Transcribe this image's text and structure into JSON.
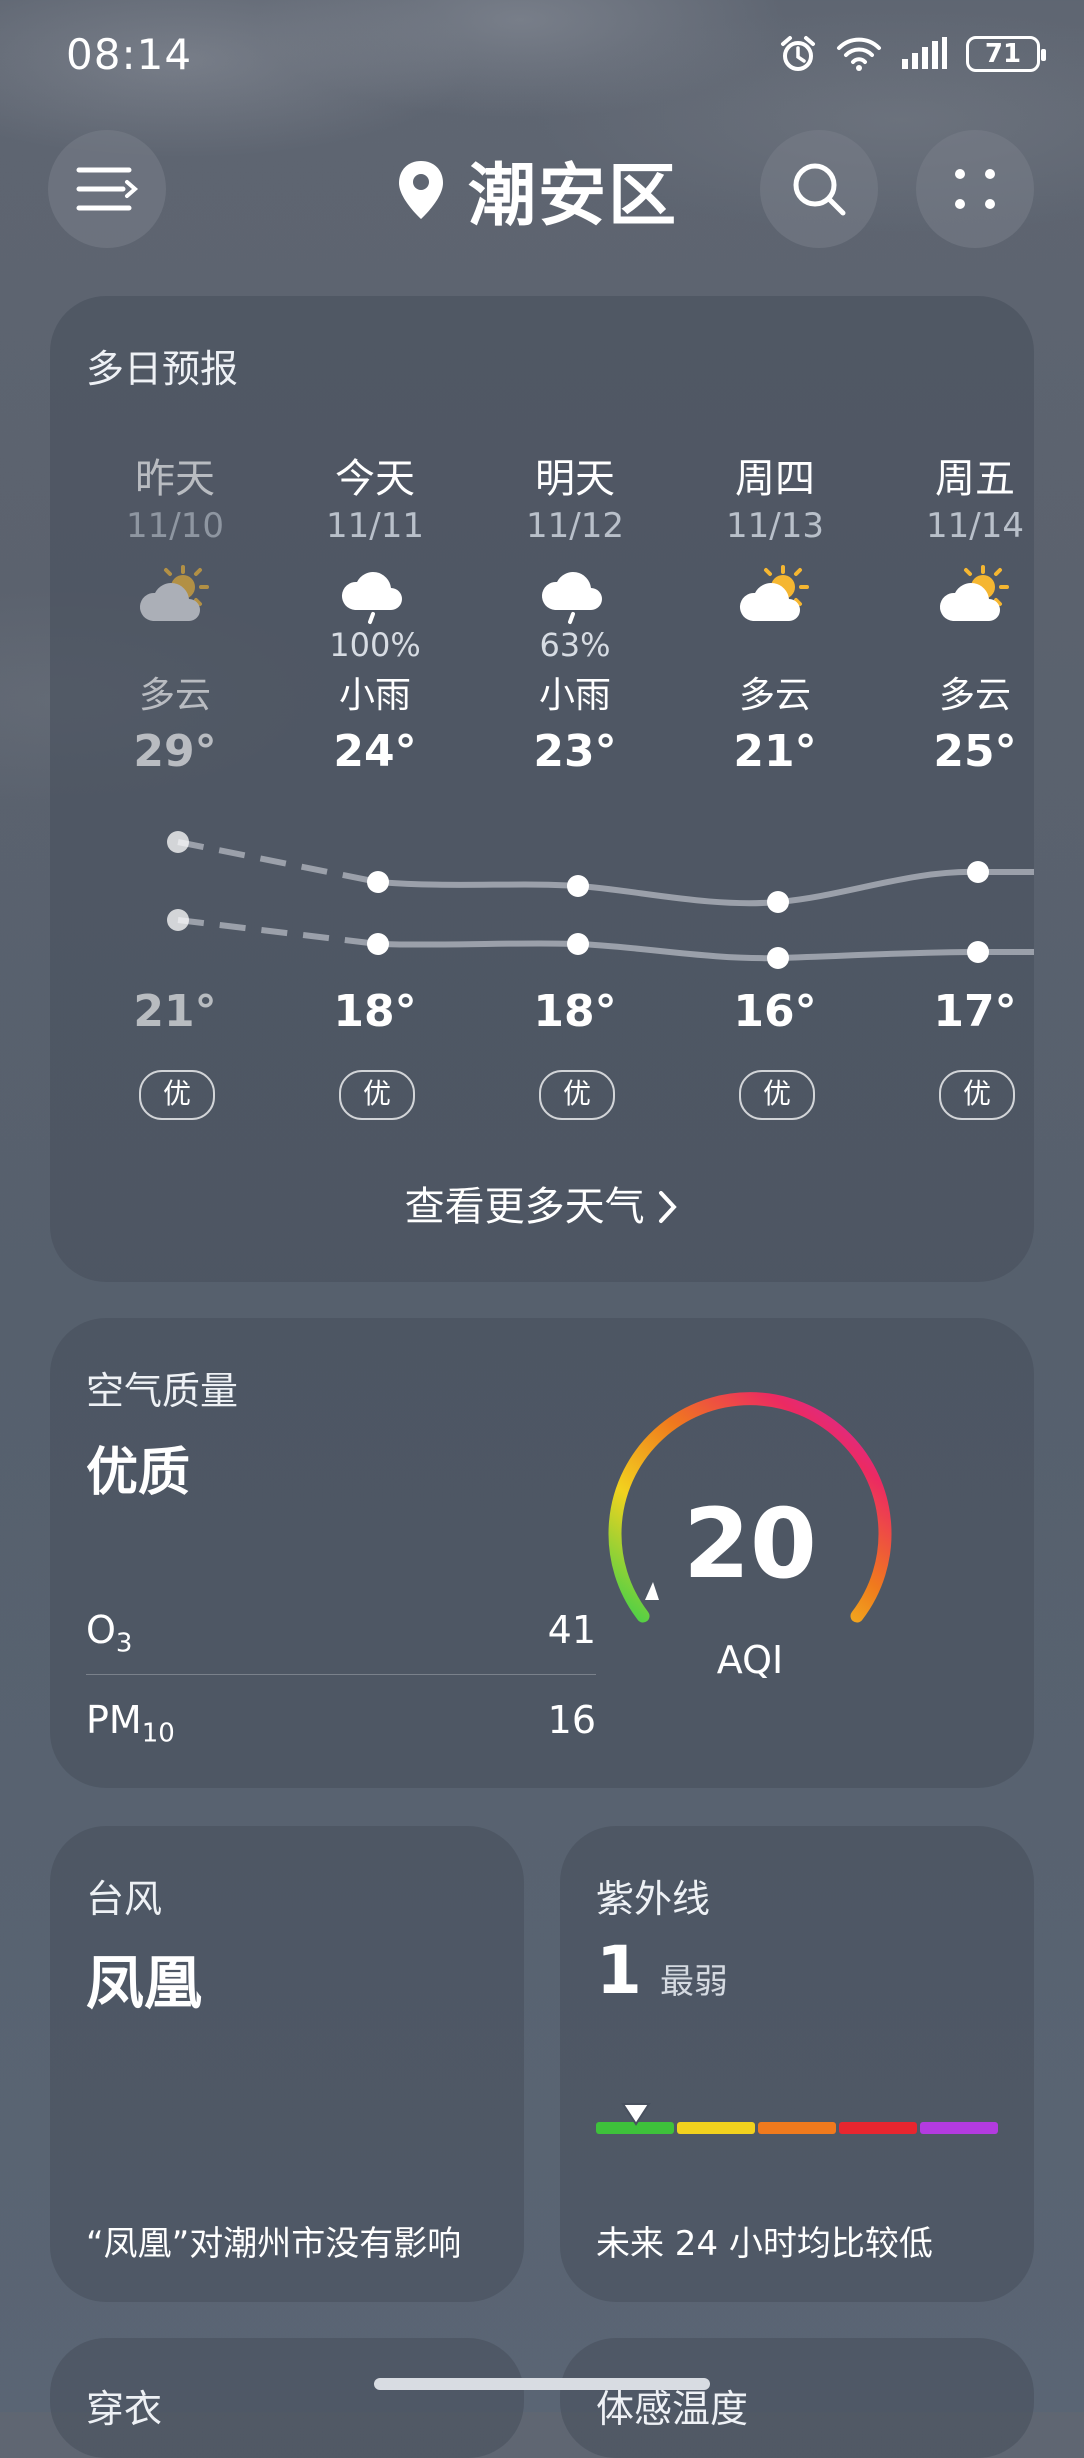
{
  "status_bar": {
    "time": "08:14",
    "battery": "71"
  },
  "header": {
    "location": "潮安区",
    "icons": [
      "menu-icon",
      "location-pin-icon",
      "search-icon",
      "more-grid-icon"
    ]
  },
  "forecast": {
    "title": "多日预报",
    "days": [
      {
        "name": "昨天",
        "date": "11/10",
        "icon": "partly-cloudy-icon",
        "precip": "",
        "cond": "多云",
        "high": "29°",
        "low": "21°",
        "aqi": "优"
      },
      {
        "name": "今天",
        "date": "11/11",
        "icon": "light-rain-icon",
        "precip": "100%",
        "cond": "小雨",
        "high": "24°",
        "low": "18°",
        "aqi": "优"
      },
      {
        "name": "明天",
        "date": "11/12",
        "icon": "light-rain-icon",
        "precip": "63%",
        "cond": "小雨",
        "high": "23°",
        "low": "18°",
        "aqi": "优"
      },
      {
        "name": "周四",
        "date": "11/13",
        "icon": "partly-cloudy-icon",
        "precip": "",
        "cond": "多云",
        "high": "21°",
        "low": "16°",
        "aqi": "优"
      },
      {
        "name": "周五",
        "date": "11/14",
        "icon": "partly-cloudy-icon",
        "precip": "",
        "cond": "多云",
        "high": "25°",
        "low": "17°",
        "aqi": "优"
      }
    ],
    "more_link": "查看更多天气"
  },
  "air_quality": {
    "title": "空气质量",
    "status": "优质",
    "pollutants": [
      {
        "name": "O",
        "sub": "3",
        "value": "41"
      },
      {
        "name": "PM",
        "sub": "10",
        "value": "16"
      }
    ],
    "aqi": "20",
    "aqi_label": "AQI"
  },
  "typhoon": {
    "title": "台风",
    "name": "凤凰",
    "note": "“凤凰”对潮州市没有影响"
  },
  "uv": {
    "title": "紫外线",
    "value": "1",
    "level": "最弱",
    "note": "未来 24 小时均比较低",
    "scale_colors": [
      "#3ec13b",
      "#f2d21e",
      "#f07a1d",
      "#e8262f",
      "#b33be0"
    ],
    "level_fraction": 0.1
  },
  "partial_cards": {
    "left_title": "穿衣",
    "right_title": "体感温度"
  }
}
